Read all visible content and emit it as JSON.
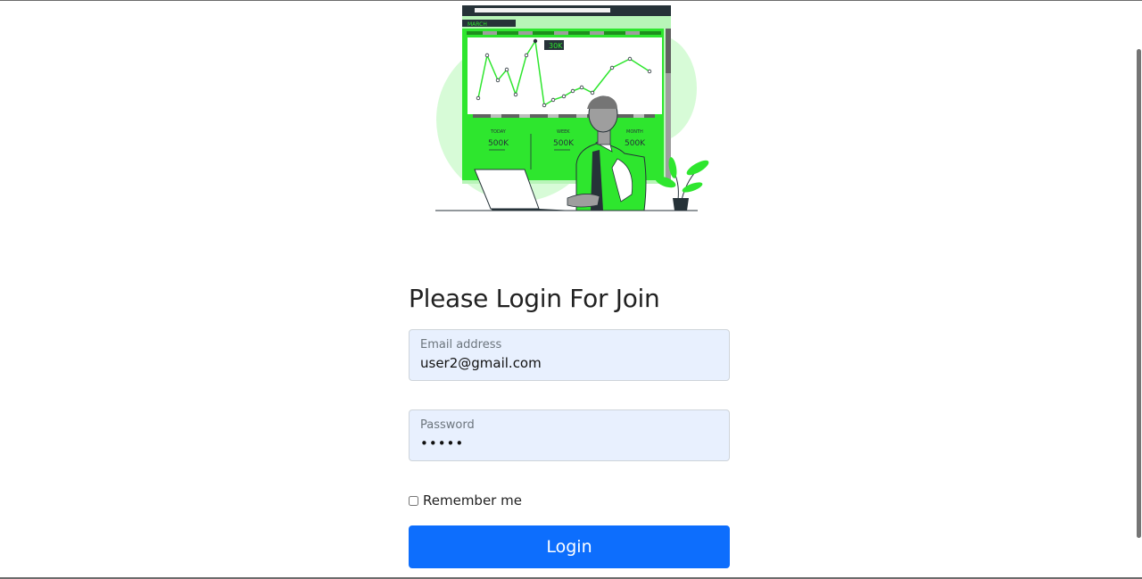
{
  "illustration": {
    "dashboard_month": "MARCH",
    "peak_badge": "30K",
    "stats": [
      {
        "label": "TODAY",
        "value": "500K"
      },
      {
        "label": "WEEK",
        "value": "500K"
      },
      {
        "label": "MONTH",
        "value": "500K"
      }
    ]
  },
  "form": {
    "title": "Please Login For Join",
    "email_label": "Email address",
    "email_value": "user2@gmail.com",
    "password_label": "Password",
    "password_value": "•••••",
    "remember_label": "Remember me",
    "remember_checked": false,
    "login_label": "Login"
  },
  "colors": {
    "accent": "#0d6efd",
    "input_bg": "#e8f0fe",
    "illustration_green": "#2ee62e"
  }
}
